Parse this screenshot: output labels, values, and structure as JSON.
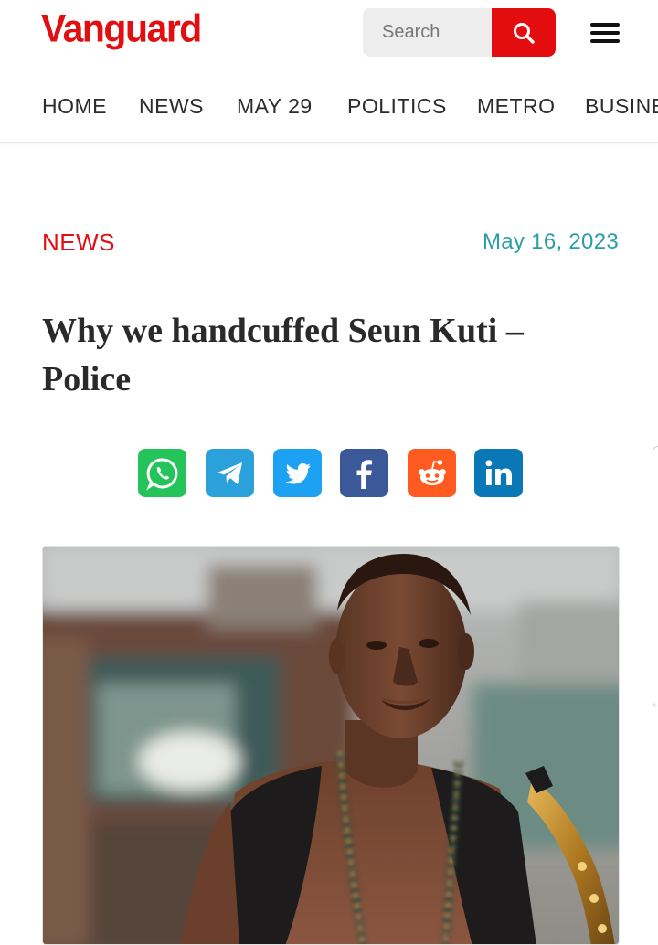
{
  "brand": {
    "name": "Vanguard",
    "color": "#e10f12"
  },
  "search": {
    "placeholder": "Search",
    "icon": "search-icon"
  },
  "menu": {
    "icon": "hamburger-menu-icon"
  },
  "nav": {
    "items": [
      {
        "label": "HOME"
      },
      {
        "label": "NEWS"
      },
      {
        "label": "MAY 29"
      },
      {
        "label": "POLITICS"
      },
      {
        "label": "METRO"
      },
      {
        "label": "BUSINE"
      }
    ]
  },
  "article": {
    "category": "NEWS",
    "date": "May 16, 2023",
    "title": "Why we handcuffed Seun Kuti – Police",
    "image": {
      "subject": "photo",
      "icon": "article-photo"
    }
  },
  "share": {
    "buttons": [
      {
        "name": "whatsapp",
        "icon": "whatsapp-icon",
        "color": "#25c45a"
      },
      {
        "name": "telegram",
        "icon": "telegram-icon",
        "color": "#2aa1da"
      },
      {
        "name": "twitter",
        "icon": "twitter-icon",
        "color": "#1da1f2"
      },
      {
        "name": "facebook",
        "icon": "facebook-icon",
        "color": "#3b5998"
      },
      {
        "name": "reddit",
        "icon": "reddit-icon",
        "color": "#ff5a1f"
      },
      {
        "name": "linkedin",
        "icon": "linkedin-icon",
        "color": "#0a78b6"
      }
    ]
  },
  "colors": {
    "accent": "#e10f12",
    "date": "#2a9ea8",
    "text": "#2a2a2a"
  }
}
